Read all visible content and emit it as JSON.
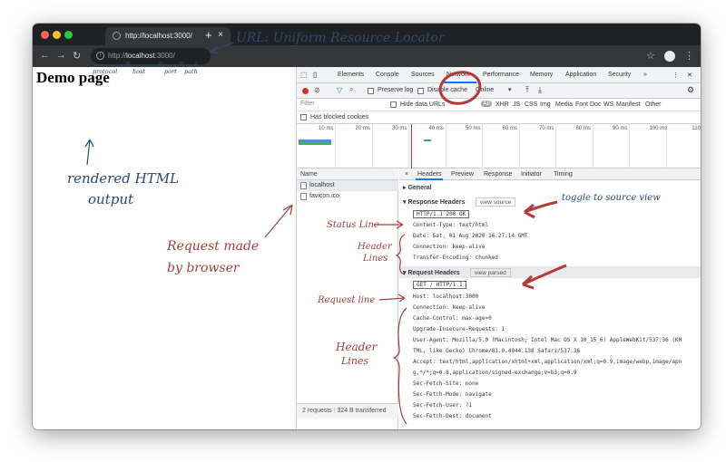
{
  "browser": {
    "tab_title": "http://localhost:3000/",
    "tab_close": "×",
    "new_tab": "+",
    "address": {
      "protocol": "http://",
      "host": "localhost",
      "rest": ":3000/"
    },
    "colors": {
      "close": "#ff5f57",
      "minimize": "#febc2e",
      "zoom": "#28c840",
      "titlebar": "#202124"
    }
  },
  "page": {
    "heading": "Demo page"
  },
  "devtools": {
    "tabs": [
      "Elements",
      "Console",
      "Sources",
      "Network",
      "Performance",
      "Memory",
      "Application",
      "Security",
      "»"
    ],
    "active_tab": "Network",
    "preserve_log": "Preserve log",
    "disable_cache": "Disable cache",
    "throttle": "Online",
    "filter_placeholder": "Filter",
    "hide_data_urls": "Hide data URLs",
    "filter_types": [
      "All",
      "XHR",
      "JS",
      "CSS",
      "Img",
      "Media",
      "Font",
      "Doc",
      "WS",
      "Manifest",
      "Other"
    ],
    "has_blocked_cookies": "Has blocked cookies",
    "timeline_ticks": [
      "10 ms",
      "20 ms",
      "30 ms",
      "40 ms",
      "50 ms",
      "60 ms",
      "70 ms",
      "80 ms",
      "90 ms",
      "100 ms",
      "110"
    ],
    "name_header": "Name",
    "requests": [
      "localhost",
      "favicon.ico"
    ],
    "footer": {
      "requests": "2 requests",
      "transferred": "324 B transferred"
    },
    "detail_tabs": [
      "×",
      "Headers",
      "Preview",
      "Response",
      "Initiator",
      "Timing"
    ],
    "general": "▸ General",
    "response_headers_title": "▾ Response Headers",
    "view_source": "view source",
    "status_line": "HTTP/1.1 200 OK",
    "response_headers": [
      "Content-Type: text/html",
      "Date: Sat, 01 Aug 2020 16:27:14 GMT",
      "Connection: keep-alive",
      "Transfer-Encoding: chunked"
    ],
    "request_headers_title": "▾ Request Headers",
    "view_parsed": "view parsed",
    "request_line": "GET / HTTP/1.1",
    "request_headers": [
      "Host: localhost:3000",
      "Connection: keep-alive",
      "Cache-Control: max-age=0",
      "Upgrade-Insecure-Requests: 1",
      "User-Agent: Mozilla/5.0 (Macintosh; Intel Mac OS X 10_15_6) AppleWebKit/537.36 (KH",
      "TML, like Gecko) Chrome/81.0.4044.138 Safari/537.36",
      "Accept: text/html,application/xhtml+xml,application/xml;q=0.9,image/webp,image/apn",
      "g,*/*;q=0.8,application/signed-exchange;v=b3;q=0.9",
      "Sec-Fetch-Site: none",
      "Sec-Fetch-Mode: navigate",
      "Sec-Fetch-User: ?1",
      "Sec-Fetch-Dest: document"
    ]
  },
  "annotations": {
    "url": "URL: Uniform Resource Locator",
    "url_parts": [
      "protocol",
      "host",
      "port",
      "path"
    ],
    "rendered_line1": "rendered HTML",
    "rendered_line2": "output",
    "request_made_line1": "Request made",
    "request_made_line2": "by browser",
    "status_line": "Status Line",
    "header_lines_1_a": "Header",
    "header_lines_1_b": "Lines",
    "request_line": "Request line",
    "header_lines_2_a": "Header",
    "header_lines_2_b": "Lines",
    "toggle": "toggle to source view"
  }
}
